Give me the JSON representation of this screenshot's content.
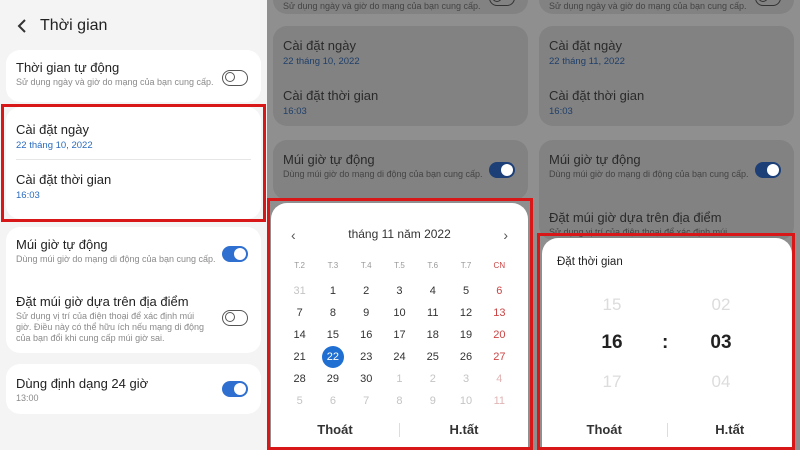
{
  "header": {
    "title": "Thời gian"
  },
  "settings": {
    "auto_time": {
      "title": "Thời gian tự động",
      "sub": "Sử dụng ngày và giờ do mạng của bạn cung cấp."
    },
    "set_date": {
      "title": "Cài đặt ngày",
      "value": "22 tháng 10, 2022",
      "value_p3": "22 tháng 11, 2022"
    },
    "set_time": {
      "title": "Cài đặt thời gian",
      "value": "16:03"
    },
    "auto_tz": {
      "title": "Múi giờ tự động",
      "sub": "Dùng múi giờ do mạng di động của bạn cung cấp."
    },
    "tz_location": {
      "title": "Đặt múi giờ dựa trên địa điểm",
      "sub1": "Sử dụng vị trí của điện thoại để xác định múi",
      "sub2": "giờ. Điều này có thể hữu ích nếu mạng di động",
      "sub3": "của bạn đổi khi cung cấp múi giờ sai."
    },
    "format24": {
      "title": "Dùng định dạng 24 giờ",
      "value": "13:00"
    },
    "top_fragment": {
      "sub": "Sử dụng ngày và giờ do mạng của bạn cung cấp."
    }
  },
  "calendar": {
    "month_title": "tháng 11 năm 2022",
    "weekdays": [
      "T.2",
      "T.3",
      "T.4",
      "T.5",
      "T.6",
      "T.7",
      "CN"
    ],
    "weeks": [
      [
        "31",
        "1",
        "2",
        "3",
        "4",
        "5",
        "6"
      ],
      [
        "7",
        "8",
        "9",
        "10",
        "11",
        "12",
        "13"
      ],
      [
        "14",
        "15",
        "16",
        "17",
        "18",
        "19",
        "20"
      ],
      [
        "21",
        "22",
        "23",
        "24",
        "25",
        "26",
        "27"
      ],
      [
        "28",
        "29",
        "30",
        "1",
        "2",
        "3",
        "4"
      ],
      [
        "5",
        "6",
        "7",
        "8",
        "9",
        "10",
        "11"
      ]
    ],
    "muted_cells": [
      [
        0,
        0
      ],
      [
        4,
        3
      ],
      [
        4,
        4
      ],
      [
        4,
        5
      ],
      [
        4,
        6
      ],
      [
        5,
        0
      ],
      [
        5,
        1
      ],
      [
        5,
        2
      ],
      [
        5,
        3
      ],
      [
        5,
        4
      ],
      [
        5,
        5
      ],
      [
        5,
        6
      ]
    ],
    "selected_cell": [
      3,
      1
    ],
    "cancel_label": "Thoát",
    "done_label": "H.tất"
  },
  "time_picker": {
    "title": "Đặt thời gian",
    "hours": [
      "15",
      "16",
      "17"
    ],
    "minutes": [
      "02",
      "03",
      "04"
    ],
    "separator": ":",
    "cancel_label": "Thoát",
    "done_label": "H.tất"
  },
  "colors": {
    "accent": "#1f6fd3",
    "highlight": "#d81818",
    "value_text": "#2b6bbf",
    "sunday": "#cc4444"
  }
}
